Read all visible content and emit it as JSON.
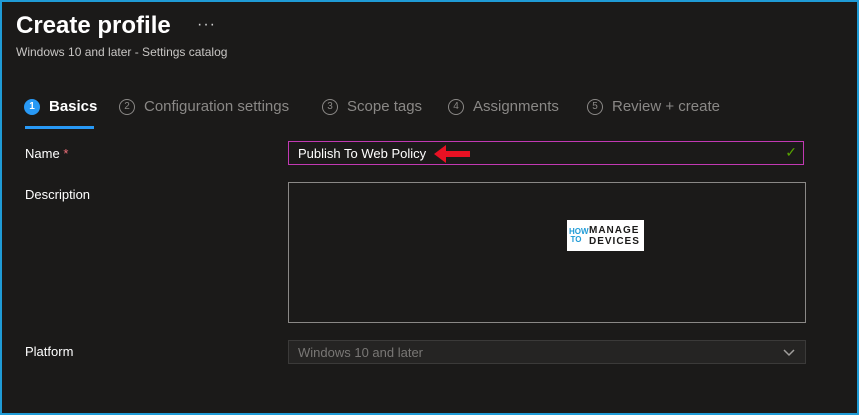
{
  "header": {
    "title": "Create profile",
    "more_label": "···",
    "subtitle": "Windows 10 and later - Settings catalog"
  },
  "steps": [
    {
      "num": "1",
      "label": "Basics",
      "active": true
    },
    {
      "num": "2",
      "label": "Configuration settings",
      "active": false
    },
    {
      "num": "3",
      "label": "Scope tags",
      "active": false
    },
    {
      "num": "4",
      "label": "Assignments",
      "active": false
    },
    {
      "num": "5",
      "label": "Review + create",
      "active": false
    }
  ],
  "form": {
    "name_label": "Name",
    "required_mark": "*",
    "name_value": "Publish To Web Policy",
    "description_label": "Description",
    "description_value": "",
    "platform_label": "Platform",
    "platform_value": "Windows 10 and later"
  },
  "watermark": {
    "line1": "HOW",
    "line2": "TO",
    "line3": "MANAGE",
    "line4": "DEVICES"
  },
  "colors": {
    "accent": "#2899f5",
    "focus_border": "#c239b3",
    "valid_check": "#57a300",
    "arrow": "#e81123"
  },
  "icons": {
    "check": "checkmark-icon",
    "chevron": "chevron-down-icon",
    "arrow": "red-arrow-annotation"
  }
}
